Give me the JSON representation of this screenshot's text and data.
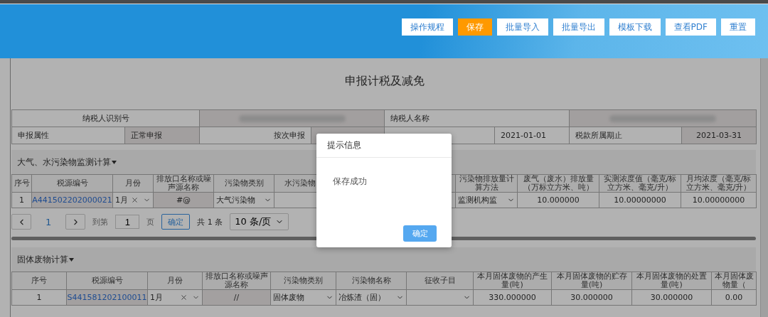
{
  "toolbar": {
    "buttons": [
      {
        "label": "操作规程",
        "primary": false
      },
      {
        "label": "保存",
        "primary": true
      },
      {
        "label": "批量导入",
        "primary": false
      },
      {
        "label": "批量导出",
        "primary": false
      },
      {
        "label": "模板下载",
        "primary": false
      },
      {
        "label": "查看PDF",
        "primary": false
      },
      {
        "label": "重置",
        "primary": false
      }
    ]
  },
  "page_title": "申报计税及减免",
  "taxpayer_info": {
    "id_label": "纳税人识别号",
    "id_value_redacted": true,
    "name_label": "纳税人名称",
    "name_value_redacted": true,
    "declare_type_label": "申报属性",
    "declare_type_value": "正常申报",
    "per_time_label": "按次申报",
    "period_start_value": "2021-01-01",
    "period_end_label": "税款所属期止",
    "period_end_value": "2021-03-31"
  },
  "sections": [
    {
      "title": "大气、水污染物监测计算",
      "columns": [
        {
          "label": "序号"
        },
        {
          "label": "税源编号"
        },
        {
          "label": "月份"
        },
        {
          "label": "排放口名称或噪声源名称"
        },
        {
          "label": "污染物类别"
        },
        {
          "label": "水污染物"
        },
        {
          "label": "污染物排放量计算方法"
        },
        {
          "label": "废气（废水）排放量（万标立方米、吨）"
        },
        {
          "label": "实测浓度值（毫克/标立方米、毫克/升）"
        },
        {
          "label": "月均浓度（毫克/标立方米、毫克/升）"
        }
      ],
      "rows": [
        {
          "cells": [
            {
              "kind": "text",
              "text": "1"
            },
            {
              "kind": "link",
              "text": "A441502202000021"
            },
            {
              "kind": "month",
              "text": "1月"
            },
            {
              "kind": "readonly",
              "text": "#@"
            },
            {
              "kind": "select",
              "text": "大气污染物"
            },
            {
              "kind": "empty"
            },
            {
              "kind": "select",
              "text": "监测机构监"
            },
            {
              "kind": "text",
              "text": "10.000000"
            },
            {
              "kind": "text",
              "text": "10.00000000"
            },
            {
              "kind": "text",
              "text": "10.00000000"
            }
          ]
        }
      ],
      "pagination": {
        "current_page": "1",
        "goto_label": "到第",
        "goto_value": "1",
        "page_unit": "页",
        "confirm": "确定",
        "total": "共 1 条",
        "page_size": "10 条/页"
      }
    },
    {
      "title": "固体废物计算",
      "columns": [
        {
          "label": "序号"
        },
        {
          "label": "税源编号"
        },
        {
          "label": "月份"
        },
        {
          "label": "排放口名称或噪声源名称"
        },
        {
          "label": "污染物类别"
        },
        {
          "label": "污染物名称"
        },
        {
          "label": "征收子目"
        },
        {
          "label": "本月固体废物的产生量(吨)"
        },
        {
          "label": "本月固体废物的贮存量(吨)"
        },
        {
          "label": "本月固体废物的处置量(吨)"
        },
        {
          "label": "本月固体废物量（"
        }
      ],
      "rows": [
        {
          "cells": [
            {
              "kind": "text",
              "text": "1"
            },
            {
              "kind": "link",
              "text": "S441581202100011"
            },
            {
              "kind": "month",
              "text": "1月"
            },
            {
              "kind": "readonly",
              "text": "//"
            },
            {
              "kind": "select",
              "text": "固体废物"
            },
            {
              "kind": "select",
              "text": "冶炼渣（固）"
            },
            {
              "kind": "select"
            },
            {
              "kind": "text",
              "text": "330.000000"
            },
            {
              "kind": "text",
              "text": "30.000000"
            },
            {
              "kind": "text",
              "text": "30.000000"
            },
            {
              "kind": "text",
              "text": "0.00"
            }
          ]
        }
      ]
    }
  ],
  "dialog": {
    "title": "提示信息",
    "message": "保存成功",
    "ok": "确定"
  }
}
